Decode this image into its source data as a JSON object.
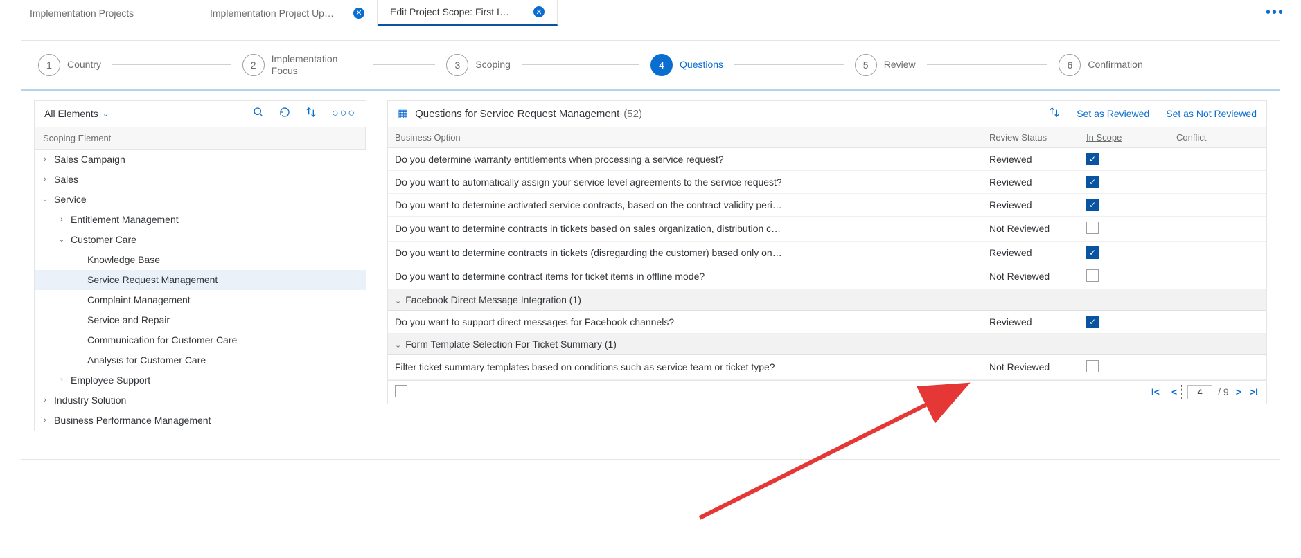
{
  "tabs": [
    {
      "label": "Implementation Projects",
      "closable": false,
      "active": false
    },
    {
      "label": "Implementation Project Up…",
      "closable": true,
      "active": false
    },
    {
      "label": "Edit Project Scope: First I…",
      "closable": true,
      "active": true
    }
  ],
  "steps": [
    {
      "num": "1",
      "label": "Country",
      "active": false
    },
    {
      "num": "2",
      "label": "Implementation Focus",
      "active": false
    },
    {
      "num": "3",
      "label": "Scoping",
      "active": false
    },
    {
      "num": "4",
      "label": "Questions",
      "active": true
    },
    {
      "num": "5",
      "label": "Review",
      "active": false
    },
    {
      "num": "6",
      "label": "Confirmation",
      "active": false
    }
  ],
  "left": {
    "filter": "All Elements",
    "header": "Scoping Element",
    "tree": [
      {
        "indent": 1,
        "arrow": "›",
        "label": "Sales Campaign"
      },
      {
        "indent": 1,
        "arrow": "›",
        "label": "Sales"
      },
      {
        "indent": 1,
        "arrow": "⌄",
        "label": "Service"
      },
      {
        "indent": 2,
        "arrow": "›",
        "label": "Entitlement Management"
      },
      {
        "indent": 2,
        "arrow": "⌄",
        "label": "Customer Care"
      },
      {
        "indent": 3,
        "arrow": "",
        "label": "Knowledge Base"
      },
      {
        "indent": 3,
        "arrow": "",
        "label": "Service Request Management",
        "selected": true
      },
      {
        "indent": 3,
        "arrow": "",
        "label": "Complaint Management"
      },
      {
        "indent": 3,
        "arrow": "",
        "label": "Service and Repair"
      },
      {
        "indent": 3,
        "arrow": "",
        "label": "Communication for Customer Care"
      },
      {
        "indent": 3,
        "arrow": "",
        "label": "Analysis for Customer Care"
      },
      {
        "indent": 2,
        "arrow": "›",
        "label": "Employee Support"
      },
      {
        "indent": 1,
        "arrow": "›",
        "label": "Industry Solution"
      },
      {
        "indent": 1,
        "arrow": "›",
        "label": "Business Performance Management"
      }
    ]
  },
  "right": {
    "title": "Questions for Service Request Management",
    "count": "(52)",
    "set_reviewed": "Set as Reviewed",
    "set_not_reviewed": "Set as Not Reviewed",
    "columns": {
      "bo": "Business Option",
      "rs": "Review Status",
      "sc": "In Scope",
      "cf": "Conflict"
    },
    "rows": [
      {
        "type": "q",
        "text": "Do you determine warranty entitlements when processing a service request?",
        "status": "Reviewed",
        "in_scope": true
      },
      {
        "type": "q",
        "text": "Do you want to automatically assign your service level agreements to the service request?",
        "status": "Reviewed",
        "in_scope": true
      },
      {
        "type": "q",
        "text": "Do you want to determine activated service contracts, based on the contract validity peri…",
        "status": "Reviewed",
        "in_scope": true
      },
      {
        "type": "q",
        "text": "Do you want to determine contracts in tickets based on sales organization, distribution c…",
        "status": "Not Reviewed",
        "in_scope": false
      },
      {
        "type": "q",
        "text": "Do you want to determine contracts in tickets (disregarding the customer) based only on…",
        "status": "Reviewed",
        "in_scope": true
      },
      {
        "type": "q",
        "text": "Do you want to determine contract items for ticket items in offline mode?",
        "status": "Not Reviewed",
        "in_scope": false
      },
      {
        "type": "g",
        "text": "Facebook Direct Message Integration (1)"
      },
      {
        "type": "q",
        "text": "Do you want to support direct messages for Facebook channels?",
        "status": "Reviewed",
        "in_scope": true
      },
      {
        "type": "g",
        "text": "Form Template Selection For Ticket Summary (1)"
      },
      {
        "type": "q",
        "text": "Filter ticket summary templates based on conditions such as service team or ticket type?",
        "status": "Not Reviewed",
        "in_scope": false
      }
    ],
    "pager": {
      "page": "4",
      "total": "/ 9"
    }
  }
}
